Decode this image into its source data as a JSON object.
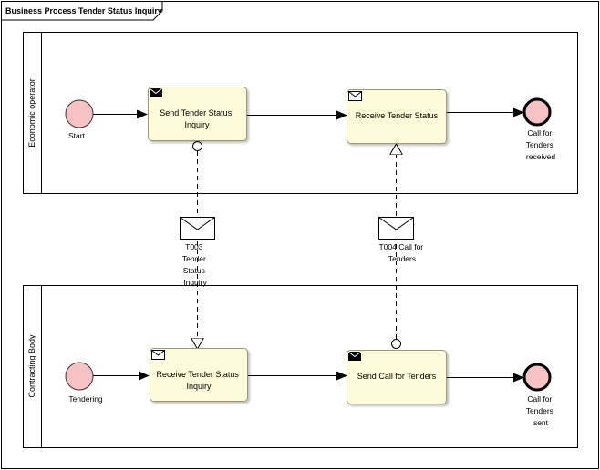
{
  "frame": {
    "title": "Business Process Tender Status Inquiry"
  },
  "pools": {
    "economic": {
      "label": "Economic operator",
      "start_event": "Start",
      "task_send": [
        "Send Tender Status",
        "Inquiry"
      ],
      "task_receive": [
        "Receive Tender Status"
      ],
      "end_event": [
        "Call for",
        "Tenders",
        "received"
      ]
    },
    "contracting": {
      "label": "Contracting Body",
      "start_event": "Tendering",
      "task_receive": [
        "Receive Tender Status",
        "Inquiry"
      ],
      "task_send": [
        "Send Call for Tenders"
      ],
      "end_event": [
        "Call for",
        "Tenders",
        "sent"
      ]
    }
  },
  "messages": {
    "t003": [
      "T003",
      "Tender",
      "Status",
      "Inquiry"
    ],
    "t004": [
      "T004 Call for",
      "Tenders"
    ]
  },
  "colors": {
    "task_fill": "#fdfbd9",
    "task_stroke": "#9a9a7a",
    "event_fill": "#f6c2c4",
    "event_stroke": "#333333"
  }
}
